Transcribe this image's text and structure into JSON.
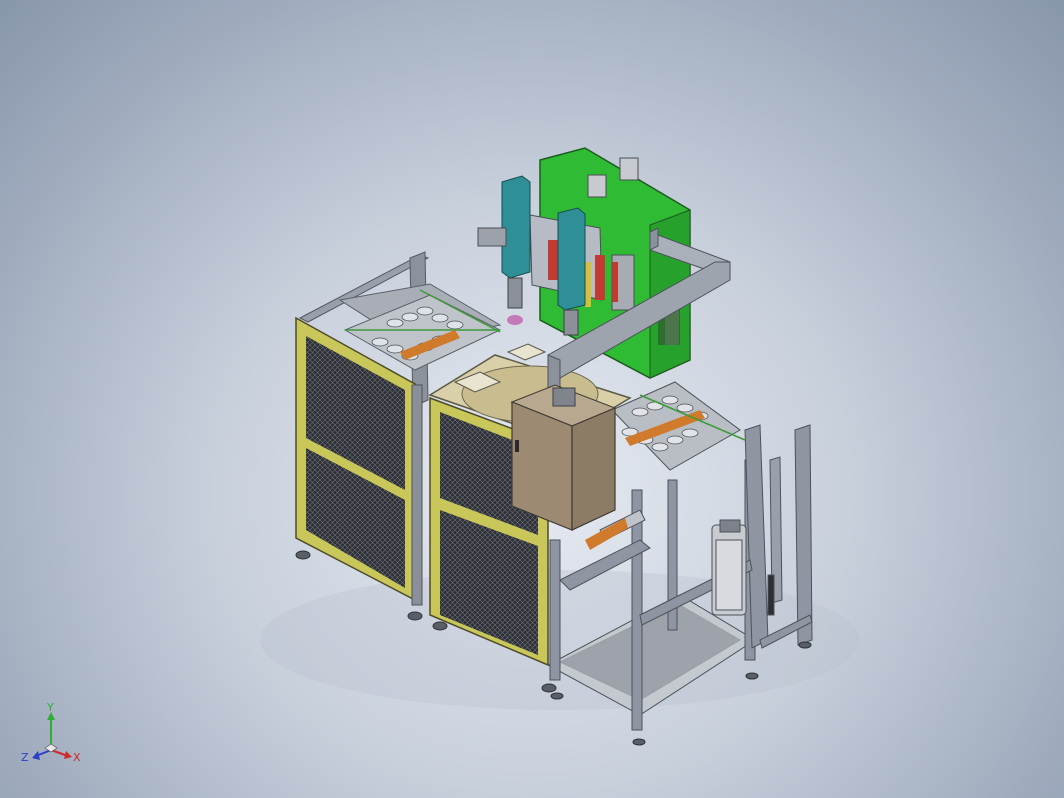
{
  "window": {
    "title": ""
  },
  "colors": {
    "background_center": "#e6eaf1",
    "background_edge": "#8896ab",
    "frame_gray": "#8f95a3",
    "guard_yellow": "#c9c65a",
    "mesh_dark": "#3a3d44",
    "press_green": "#39c43a",
    "actuator_teal": "#2f8f96",
    "cabinet_tan": "#9c8a72",
    "table_beige": "#d9cfa8",
    "axis_x": "#d12a2a",
    "axis_y": "#2fae35",
    "axis_z": "#2b3fc7"
  },
  "triad": {
    "x_label": "X",
    "y_label": "Y",
    "z_label": "Z"
  },
  "model": {
    "icon": "assembly-machine-isometric",
    "view": "isometric"
  }
}
